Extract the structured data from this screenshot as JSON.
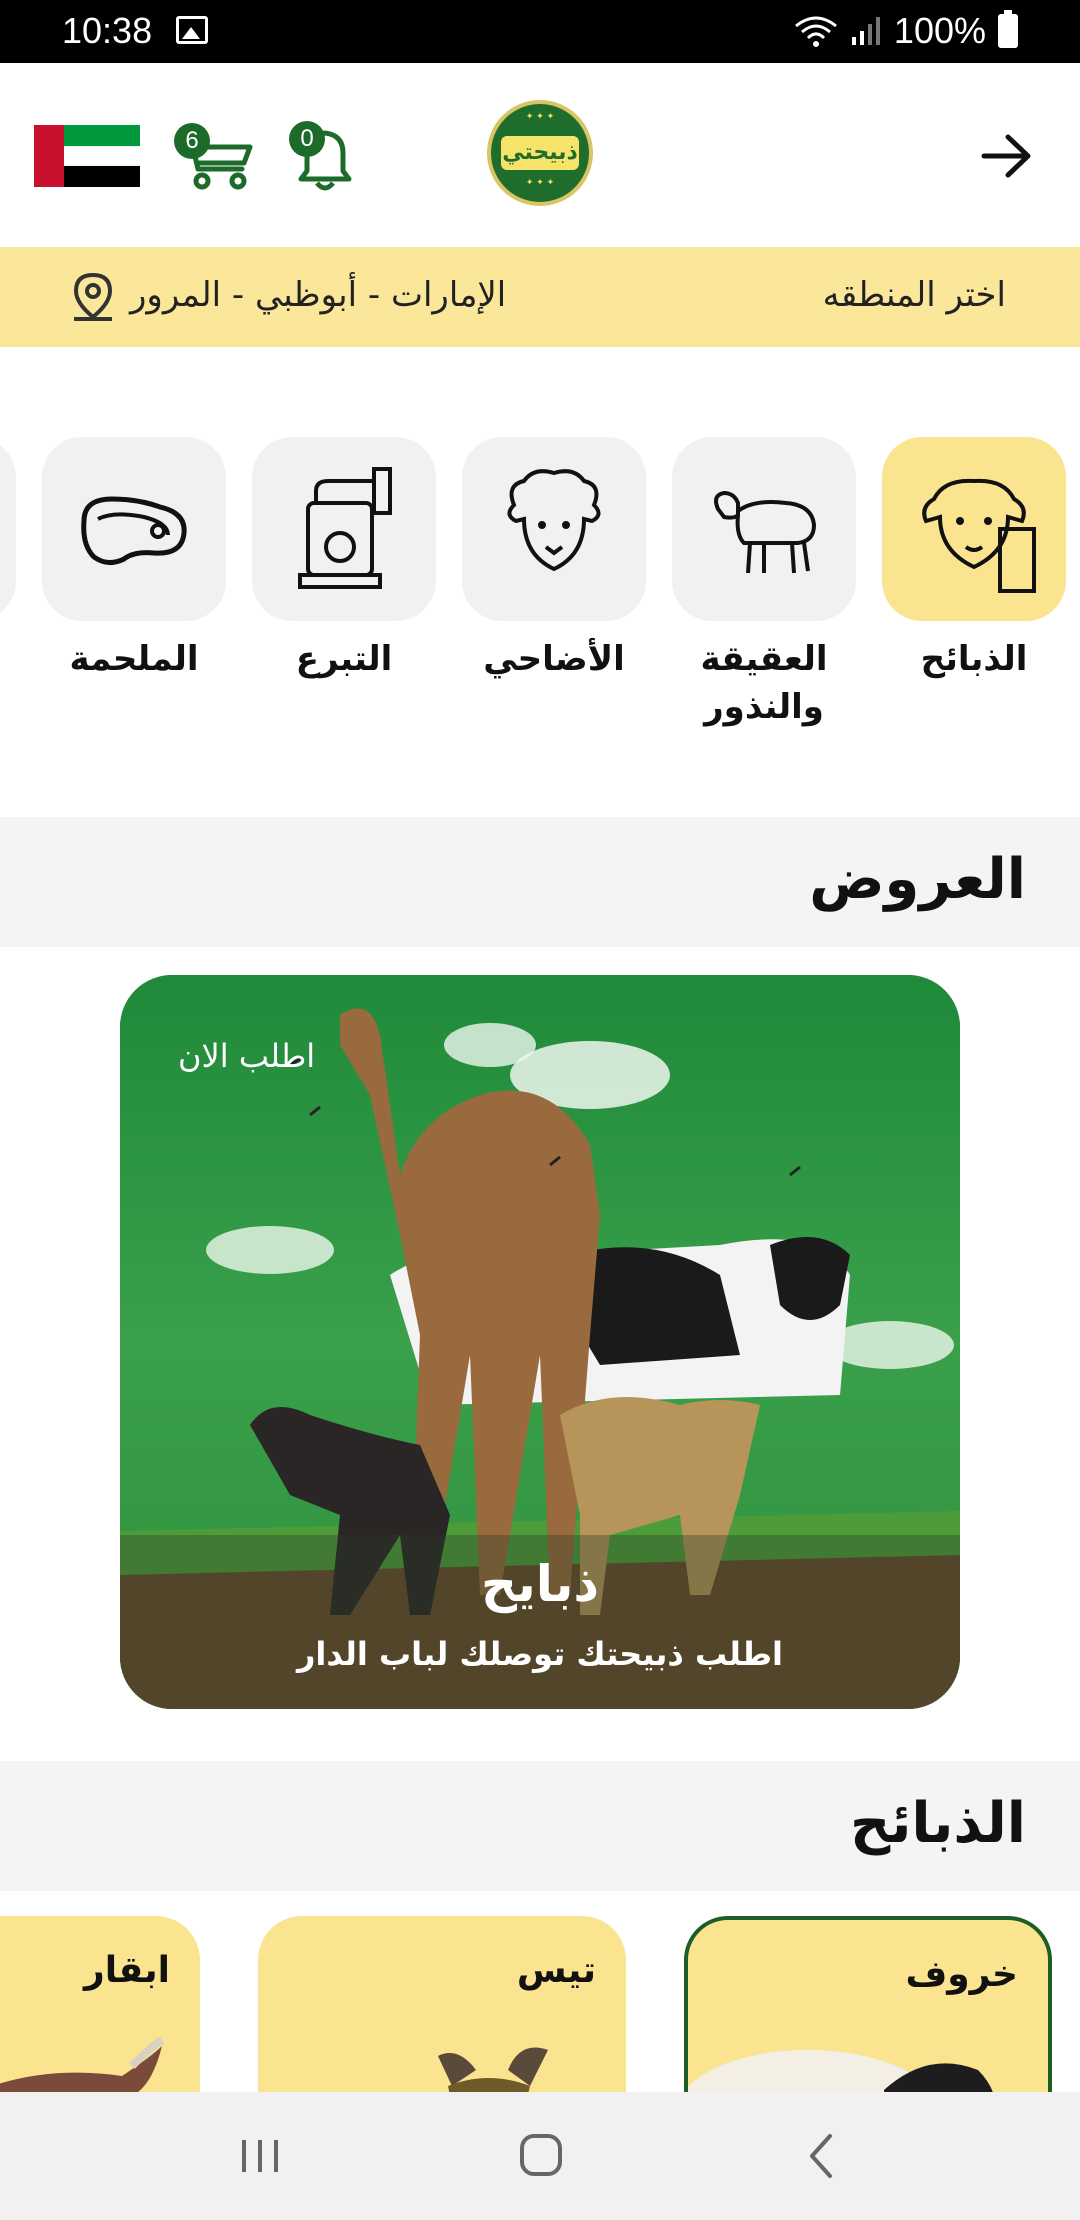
{
  "status_bar": {
    "time": "10:38",
    "battery": "100%"
  },
  "header": {
    "cart_count": "6",
    "notification_count": "0",
    "logo_text": "ذبيحتي"
  },
  "region": {
    "label": "اختر المنطقه",
    "value": "الإمارات - أبوظبي - المرور"
  },
  "categories": [
    {
      "label": "الذبائح",
      "icon": "sheep-face-icon",
      "active": true
    },
    {
      "label": "العقيقة والنذور",
      "icon": "sheep-icon",
      "active": false
    },
    {
      "label": "الأضاحي",
      "icon": "curly-sheep-icon",
      "active": false
    },
    {
      "label": "التبرع",
      "icon": "donation-box-icon",
      "active": false
    },
    {
      "label": "الملحمة",
      "icon": "steak-icon",
      "active": false
    }
  ],
  "offers": {
    "title": "العروض",
    "banner": {
      "order_now": "اطلب الان",
      "title": "ذبايح",
      "subtitle": "اطلب ذبيحتك توصلك لباب الدار"
    }
  },
  "slaughter": {
    "title": "الذبائح",
    "products": [
      {
        "name": "خروف"
      },
      {
        "name": "تيس"
      },
      {
        "name": "ابقار"
      }
    ]
  },
  "colors": {
    "accent_yellow": "#fbe48f",
    "brand_green": "#1d6b2a"
  }
}
